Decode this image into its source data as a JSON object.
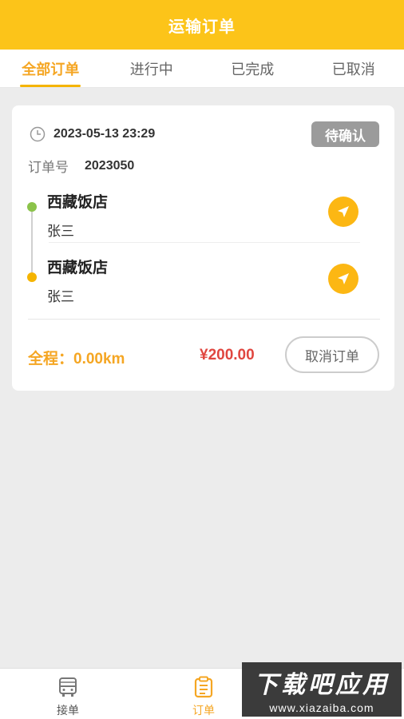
{
  "header": {
    "title": "运输订单"
  },
  "tabs": [
    {
      "label": "全部订单",
      "active": true
    },
    {
      "label": "进行中",
      "active": false
    },
    {
      "label": "已完成",
      "active": false
    },
    {
      "label": "已取消",
      "active": false
    }
  ],
  "order": {
    "datetime": "2023-05-13 23:29",
    "status": "待确认",
    "order_label": "订单号",
    "order_number": "2023050",
    "pickup": {
      "name": "西藏饭店",
      "person": "张三"
    },
    "dropoff": {
      "name": "西藏饭店",
      "person": "张三"
    },
    "distance": "全程：0.00km",
    "price": "¥200.00",
    "cancel_label": "取消订单"
  },
  "colors": {
    "brand": "#fcc419",
    "accent": "#f5a623",
    "price": "#e0463f",
    "status_badge": "#9b9b9b"
  },
  "tabbar": {
    "items": [
      {
        "label": "接单",
        "icon": "bus-icon"
      },
      {
        "label": "订单",
        "icon": "clipboard-icon"
      }
    ]
  },
  "watermark": {
    "title": "下载吧应用",
    "url": "www.xiazaiba.com"
  }
}
